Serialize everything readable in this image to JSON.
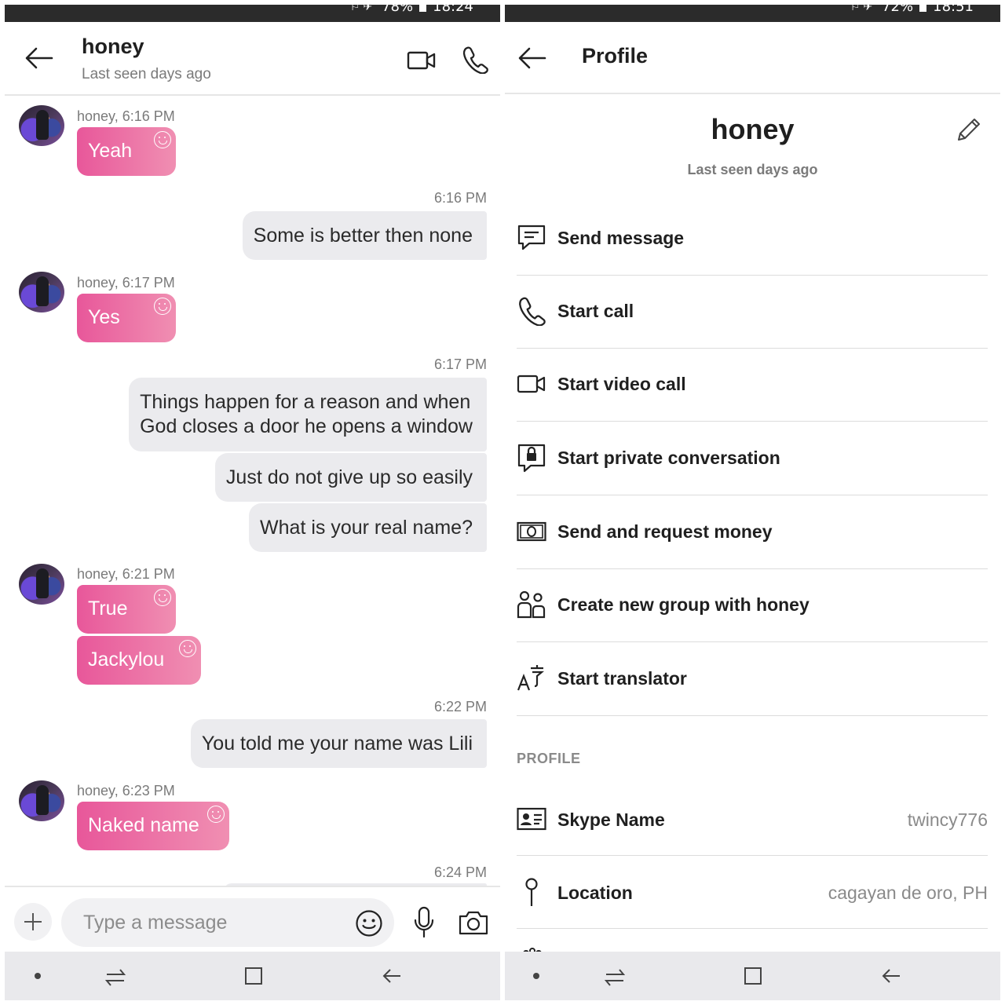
{
  "status_left": {
    "battery": "78%",
    "time": "18:24"
  },
  "status_right": {
    "battery": "72%",
    "time": "18:51"
  },
  "chat": {
    "contact_name": "honey",
    "last_seen": "Last seen days ago",
    "input_placeholder": "Type a message",
    "messages": [
      {
        "sender_line": "honey, 6:16 PM",
        "text": "Yeah"
      },
      {
        "time": "6:16 PM",
        "text": "Some is better then none"
      },
      {
        "sender_line": "honey, 6:17 PM",
        "text": "Yes"
      },
      {
        "time": "6:17 PM",
        "text": "Things happen for a reason and when\nGod closes a door he opens a window"
      },
      {
        "text": "Just do not give up so easily"
      },
      {
        "text": "What is your real name?"
      },
      {
        "sender_line": "honey, 6:21 PM",
        "text": "True"
      },
      {
        "text": "Jackylou"
      },
      {
        "time": "6:22 PM",
        "text": "You told me your name was Lili"
      },
      {
        "sender_line": "honey, 6:23 PM",
        "text": "Naked name"
      },
      {
        "time": "6:24 PM"
      }
    ]
  },
  "profile": {
    "title": "Profile",
    "name": "honey",
    "last_seen": "Last seen days ago",
    "actions": [
      {
        "label": "Send message",
        "icon": "message-icon"
      },
      {
        "label": "Start call",
        "icon": "phone-icon"
      },
      {
        "label": "Start video call",
        "icon": "video-icon"
      },
      {
        "label": "Start private conversation",
        "icon": "lock-chat-icon"
      },
      {
        "label": "Send and request money",
        "icon": "money-icon"
      },
      {
        "label": "Create new group with honey",
        "icon": "group-icon"
      },
      {
        "label": "Start translator",
        "icon": "translator-icon"
      }
    ],
    "section_label": "PROFILE",
    "fields": [
      {
        "label": "Skype Name",
        "value": "twincy776",
        "icon": "id-card-icon"
      },
      {
        "label": "Location",
        "value": "cagayan de oro, PH",
        "icon": "location-pin-icon"
      }
    ]
  },
  "colors": {
    "incoming_bubble_start": "#e8579a",
    "incoming_bubble_end": "#f08fb2",
    "outgoing_bubble": "#ebebee",
    "status_bar": "#2b2b2b",
    "nav_bar": "#e9e9ec"
  }
}
